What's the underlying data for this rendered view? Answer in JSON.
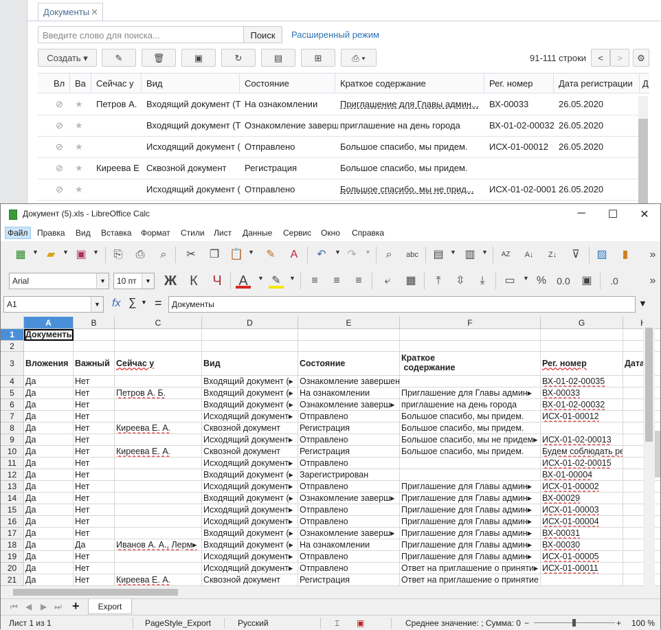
{
  "background_app": {
    "tab_title": "Документы",
    "search_placeholder": "Введите слово для поиска...",
    "search_button": "Поиск",
    "advanced_link": "Расширенный режим",
    "create_button": "Создать",
    "row_count": "91-111 строки",
    "columns": [
      "Вл",
      "Ва",
      "Сейчас у",
      "Вид",
      "Состояние",
      "Краткое содержание",
      "Рег. номер",
      "Дата регистрации",
      "Д"
    ],
    "rows": [
      {
        "now": "Петров А.",
        "kind": "Входящий документ (Т",
        "state": "На ознакомлении",
        "summary": "Приглашение для Главы админ...",
        "reg": "ВХ-00033",
        "date": "26.05.2020"
      },
      {
        "now": "",
        "kind": "Входящий документ (Т",
        "state": "Ознакомление заверш",
        "summary": "приглашение на день города",
        "reg": "ВХ-01-02-00032",
        "date": "26.05.2020"
      },
      {
        "now": "",
        "kind": "Исходящий документ (",
        "state": "Отправлено",
        "summary": "Большое спасибо, мы придем.",
        "reg": "ИСХ-01-00012",
        "date": "26.05.2020"
      },
      {
        "now": "Киреева Е",
        "kind": "Сквозной документ",
        "state": "Регистрация",
        "summary": "Большое спасибо, мы придем.",
        "reg": "",
        "date": ""
      },
      {
        "now": "",
        "kind": "Исходящий документ (",
        "state": "Отправлено",
        "summary": "Большое спасибо, мы не прид...",
        "reg": "ИСХ-01-02-0001",
        "date": "26.05.2020"
      }
    ]
  },
  "calc": {
    "title": "Документ (5).xls - LibreOffice Calc",
    "menu": [
      "Файл",
      "Правка",
      "Вид",
      "Вставка",
      "Формат",
      "Стили",
      "Лист",
      "Данные",
      "Сервис",
      "Окно",
      "Справка"
    ],
    "font_name": "Arial",
    "font_size": "10 пт",
    "bold_label": "Ж",
    "italic_label": "К",
    "underline_label": "Ч",
    "cell_ref": "A1",
    "formula_fx": "fx",
    "formula_sigma": "∑",
    "formula_eq": "=",
    "formula_value": "Документы",
    "col_letters": [
      "A",
      "B",
      "C",
      "D",
      "E",
      "F",
      "G",
      "H"
    ],
    "rows": [
      {
        "n": "1",
        "cells": [
          "Документы",
          "",
          "",
          "",
          "",
          "",
          "",
          ""
        ],
        "bold": true
      },
      {
        "n": "2",
        "cells": [
          "",
          "",
          "",
          "",
          "",
          "",
          "",
          ""
        ]
      },
      {
        "n": "3",
        "cells": [
          "Вложения",
          "Важный",
          "Сейчас у",
          "Вид",
          "Состояние",
          "Краткое\n содержание",
          "Рег. номер",
          "Дата"
        ],
        "bold": true
      },
      {
        "n": "4",
        "cells": [
          "Да",
          "Нет",
          "",
          "Входящий документ (▸",
          "Ознакомление завершено",
          "",
          "ВХ-01-02-00035",
          ""
        ]
      },
      {
        "n": "5",
        "cells": [
          "Да",
          "Нет",
          "Петров А. Б.",
          "Входящий документ (▸",
          "На ознакомлении",
          "Приглашение для Главы админ▸",
          "ВХ-00033",
          ""
        ]
      },
      {
        "n": "6",
        "cells": [
          "Да",
          "Нет",
          "",
          "Входящий документ (▸",
          "Ознакомление заверш▸",
          "приглашение на день города",
          "ВХ-01-02-00032",
          ""
        ]
      },
      {
        "n": "7",
        "cells": [
          "Да",
          "Нет",
          "",
          "Исходящий документ▸",
          "Отправлено",
          "Большое спасибо, мы придем.",
          "ИСХ-01-00012",
          ""
        ]
      },
      {
        "n": "8",
        "cells": [
          "Да",
          "Нет",
          "Киреева Е. А.",
          "Сквозной документ",
          "Регистрация",
          "Большое спасибо, мы придем.",
          "",
          ""
        ]
      },
      {
        "n": "9",
        "cells": [
          "Да",
          "Нет",
          "",
          "Исходящий документ▸",
          "Отправлено",
          "Большое спасибо, мы не придем▸",
          "ИСХ-01-02-00013",
          ""
        ]
      },
      {
        "n": "10",
        "cells": [
          "Да",
          "Нет",
          "Киреева Е. А.",
          "Сквозной документ",
          "Регистрация",
          "Большое спасибо, мы придем.",
          "Будем соблюдать режим",
          ""
        ]
      },
      {
        "n": "11",
        "cells": [
          "Да",
          "Нет",
          "",
          "Исходящий документ▸",
          "Отправлено",
          "",
          "ИСХ-01-02-00015",
          ""
        ]
      },
      {
        "n": "12",
        "cells": [
          "Да",
          "Нет",
          "",
          "Входящий документ (▸",
          "Зарегистрирован",
          "",
          "ВХ-01-00004",
          ""
        ]
      },
      {
        "n": "13",
        "cells": [
          "Да",
          "Нет",
          "",
          "Исходящий  документ▸",
          "Отправлено",
          "Приглашение для Главы админ▸",
          "ИСХ-01-00002",
          ""
        ]
      },
      {
        "n": "14",
        "cells": [
          "Да",
          "Нет",
          "",
          "Входящий документ (▸",
          "Ознакомление заверш▸",
          "Приглашение для Главы админ▸",
          "ВХ-00029",
          ""
        ]
      },
      {
        "n": "15",
        "cells": [
          "Да",
          "Нет",
          "",
          "Исходящий  документ▸",
          "Отправлено",
          "Приглашение для Главы админ▸",
          "ИСХ-01-00003",
          ""
        ]
      },
      {
        "n": "16",
        "cells": [
          "Да",
          "Нет",
          "",
          "Исходящий  документ▸",
          "Отправлено",
          "Приглашение для Главы админ▸",
          "ИСХ-01-00004",
          ""
        ]
      },
      {
        "n": "17",
        "cells": [
          "Да",
          "Нет",
          "",
          "Входящий документ (▸",
          "Ознакомление заверш▸",
          "Приглашение для Главы админ▸",
          "ВХ-00031",
          ""
        ]
      },
      {
        "n": "18",
        "cells": [
          "Да",
          "Да",
          "Иванов А. А., Лерм▸",
          "Входящий документ (▸",
          "На ознакомлении",
          "Приглашение для Главы админ▸",
          "ВХ-00030",
          ""
        ]
      },
      {
        "n": "19",
        "cells": [
          "Да",
          "Нет",
          "",
          "Исходящий  документ▸",
          "Отправлено",
          "Приглашение для Главы админ▸",
          "ИСХ-01-00005",
          ""
        ]
      },
      {
        "n": "20",
        "cells": [
          "Да",
          "Нет",
          "",
          "Исходящий  документ▸",
          "Отправлено",
          "Ответ на приглашение о приняти▸",
          "ИСХ-01-00011",
          ""
        ]
      },
      {
        "n": "21",
        "cells": [
          "Да",
          "Нет",
          "Киреева Е. А.",
          "Сквозной документ",
          "Регистрация",
          "Ответ на приглашение о принятие участия в торжественн",
          "",
          ""
        ]
      }
    ],
    "sheet_tab": "Export",
    "status": {
      "sheet": "Лист 1 из 1",
      "page_style": "PageStyle_Export",
      "language": "Русский",
      "summary": "Среднее значение: ; Сумма: 0",
      "zoom": "100 %"
    },
    "colors": {
      "selection": "#4a90d9",
      "font_color": "#d9261c",
      "highlight": "#f5e600"
    }
  }
}
